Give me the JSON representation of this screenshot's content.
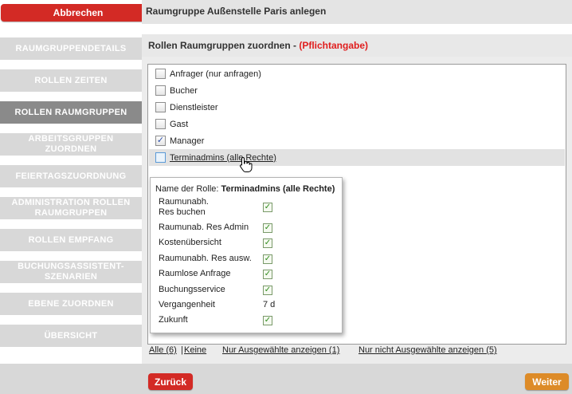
{
  "sidebar": {
    "cancel_label": "Abbrechen",
    "items": [
      {
        "label": "RAUMGRUPPENDETAILS",
        "active": false
      },
      {
        "label": "ROLLEN ZEITEN",
        "active": false
      },
      {
        "label": "ROLLEN RAUMGRUPPEN",
        "active": true
      },
      {
        "label": "ARBEITSGRUPPEN ZUORDNEN",
        "active": false
      },
      {
        "label": "FEIERTAGSZUORDNUNG",
        "active": false
      },
      {
        "label": "ADMINISTRATION ROLLEN RAUMGRUPPEN",
        "active": false
      },
      {
        "label": "ROLLEN EMPFANG",
        "active": false
      },
      {
        "label": "BUCHUNGSASSISTENT-SZENARIEN",
        "active": false
      },
      {
        "label": "EBENE ZUORDNEN",
        "active": false
      },
      {
        "label": "ÜBERSICHT",
        "active": false
      }
    ]
  },
  "header": {
    "title": "Raumgruppe Außenstelle Paris anlegen"
  },
  "section": {
    "title": "Rollen Raumgruppen zuordnen - ",
    "required": "(Pflichtangabe)"
  },
  "roles": [
    {
      "label": "Anfrager (nur anfragen)",
      "checked": false
    },
    {
      "label": "Bucher",
      "checked": false
    },
    {
      "label": "Dienstleister",
      "checked": false
    },
    {
      "label": "Gast",
      "checked": false
    },
    {
      "label": "Manager",
      "checked": true
    },
    {
      "label": "Terminadmins (alle Rechte)",
      "checked": false
    }
  ],
  "tooltip": {
    "prefix": "Name der Rolle: ",
    "role_name": "Terminadmins (alle Rechte)",
    "permissions": [
      {
        "label": "Raumunabh. Res buchen",
        "value": "check"
      },
      {
        "label": "Raumunab. Res Admin",
        "value": "check"
      },
      {
        "label": "Kostenübersicht",
        "value": "check"
      },
      {
        "label": "Raumunabh. Res ausw.",
        "value": "check"
      },
      {
        "label": "Raumlose Anfrage",
        "value": "check"
      },
      {
        "label": "Buchungsservice",
        "value": "check"
      },
      {
        "label": "Vergangenheit",
        "value": "7 d"
      },
      {
        "label": "Zukunft",
        "value": "check"
      }
    ]
  },
  "footer": {
    "all": "Alle (6)",
    "separator": " | ",
    "none": "Keine",
    "only_selected": "Nur Ausgewählte anzeigen (1)",
    "only_unselected": "Nur nicht Ausgewählte anzeigen (5)"
  },
  "buttons": {
    "back": "Zurück",
    "next": "Weiter"
  },
  "colors": {
    "red": "#d32a25",
    "orange": "#dd8b28",
    "required": "#e01e1e"
  }
}
